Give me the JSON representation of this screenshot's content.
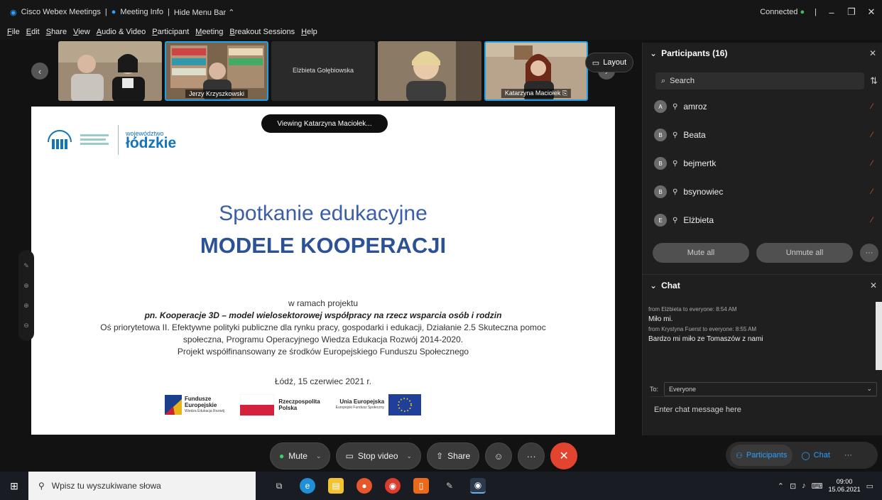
{
  "titlebar": {
    "app": "Cisco Webex Meetings",
    "meeting_info": "Meeting Info",
    "hide_menu": "Hide Menu Bar",
    "status": "Connected",
    "min": "–",
    "max": "❐",
    "close": "✕"
  },
  "menu": [
    "File",
    "Edit",
    "Share",
    "View",
    "Audio & Video",
    "Participant",
    "Meeting",
    "Breakout Sessions",
    "Help"
  ],
  "videos": {
    "tile3_name": "Elżbieta Gołębiowska",
    "tile2_name": "Jerzy Krzyszkowski",
    "tile5_name": "Katarzyna Maciołek",
    "layout_label": "Layout"
  },
  "slide": {
    "viewing_label": "Viewing Katarzyna Maciołek...",
    "logo_woj": "województwo",
    "logo_lodzkie": "łódzkie",
    "title1": "Spotkanie edukacyjne",
    "title2": "MODELE KOOPERACJI",
    "line1": "w ramach projektu",
    "line2": "pn. Kooperacje 3D – model wielosektorowej współpracy na rzecz wsparcia osób i rodzin",
    "line3": "Oś priorytetowa II. Efektywne polityki publiczne dla rynku pracy, gospodarki i edukacji, Działanie 2.5 Skuteczna pomoc",
    "line4": "społeczna, Programu Operacyjnego Wiedza Edukacja Rozwój 2014-2020.",
    "line5": "Projekt współfinansowany ze środków Europejskiego Funduszu Społecznego",
    "date": "Łódź, 15 czerwiec 2021 r.",
    "fe_1": "Fundusze",
    "fe_2": "Europejskie",
    "fe_sub": "Wiedza Edukacja Rozwój",
    "rp_1": "Rzeczpospolita",
    "rp_2": "Polska",
    "ue_1": "Unia Europejska",
    "ue_sub": "Europejski Fundusz Społeczny"
  },
  "controls": {
    "mute": "Mute",
    "stop_video": "Stop video",
    "share": "Share",
    "more": "···",
    "end": "✕"
  },
  "participants": {
    "header": "Participants (16)",
    "search_placeholder": "Search",
    "rows": [
      {
        "initial": "A",
        "name": "amroz"
      },
      {
        "initial": "B",
        "name": "Beata"
      },
      {
        "initial": "B",
        "name": "bejmertk"
      },
      {
        "initial": "B",
        "name": "bsynowiec"
      },
      {
        "initial": "E",
        "name": "Elżbieta"
      }
    ],
    "mute_all": "Mute all",
    "unmute_all": "Unmute all",
    "more": "···"
  },
  "chat": {
    "header": "Chat",
    "messages": [
      {
        "meta": "from Elżbieta to everyone:   8:54 AM",
        "text": "Miło mi."
      },
      {
        "meta": "from Krystyna Fuerst to everyone:   8:55 AM",
        "text": "Bardzo mi miło ze Tomaszów z nami"
      }
    ],
    "to_label": "To:",
    "to_value": "Everyone",
    "input_placeholder": "Enter chat message here"
  },
  "panel_tabs": {
    "participants": "Participants",
    "chat": "Chat",
    "more": "···"
  },
  "taskbar": {
    "search_placeholder": "Wpisz tu wyszukiwane słowa",
    "time": "09:00",
    "date": "15.06.2021"
  }
}
